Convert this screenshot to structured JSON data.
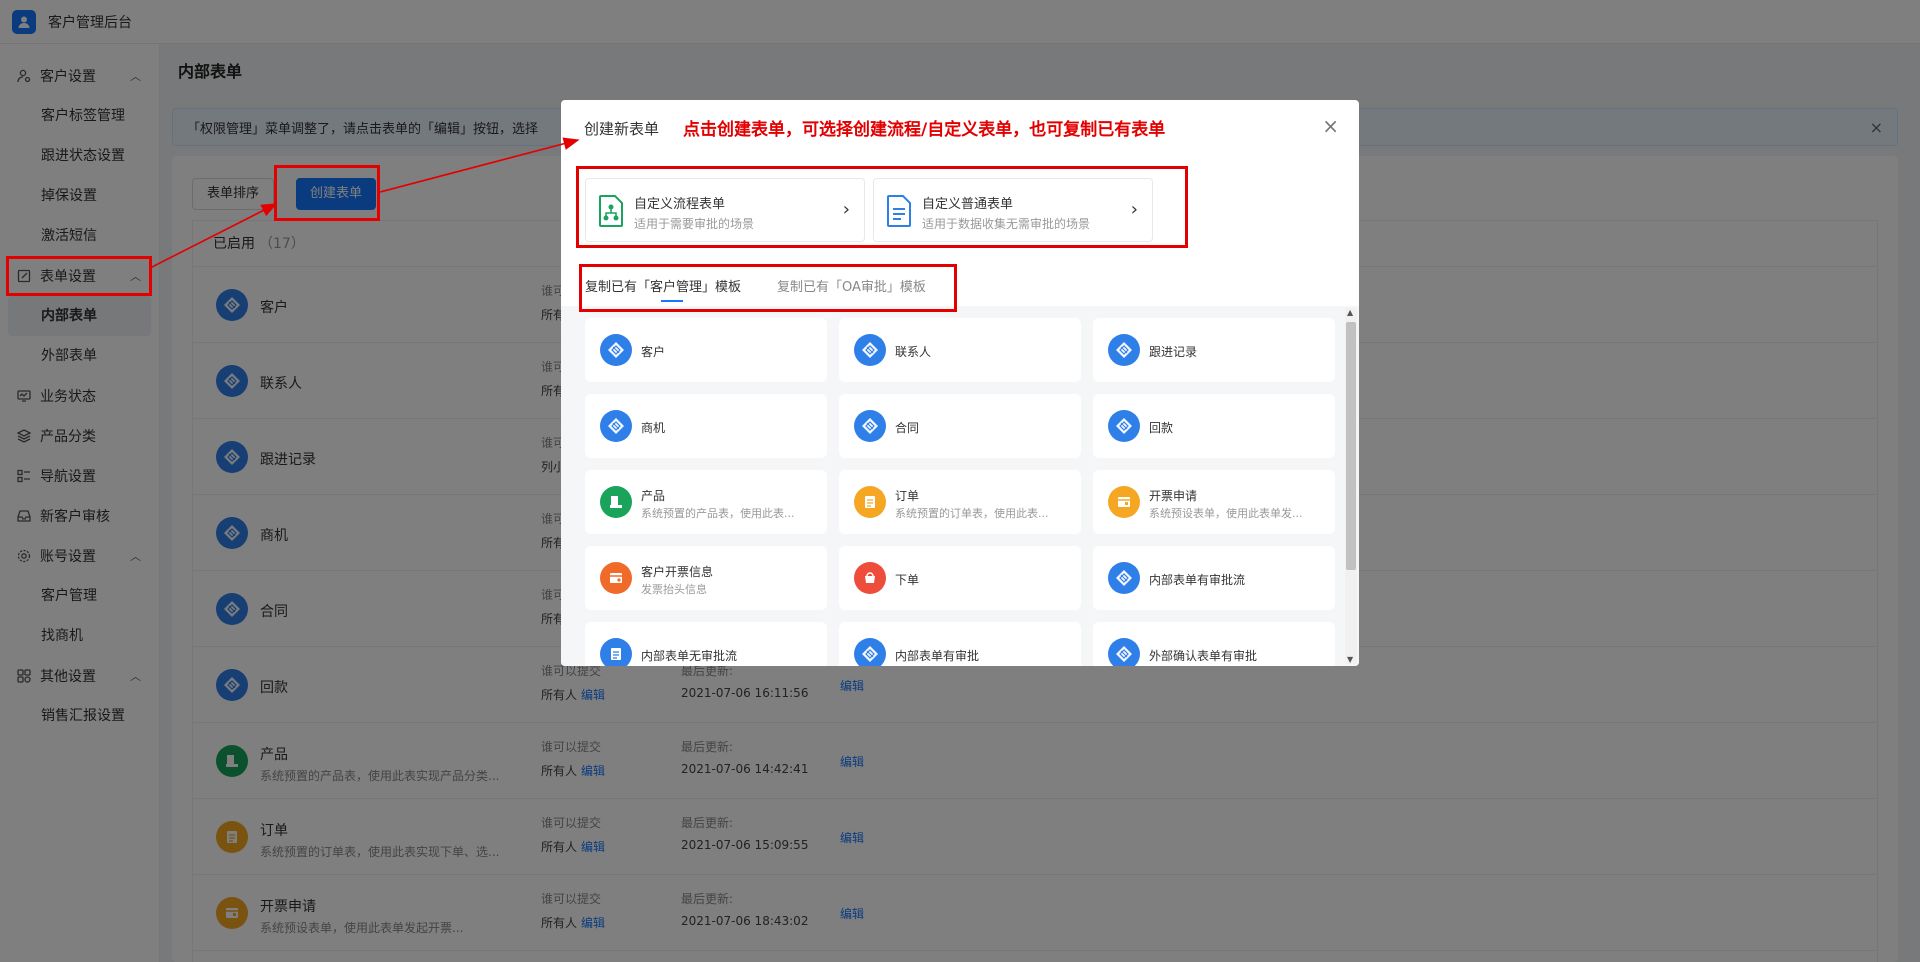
{
  "app": {
    "title": "客户管理后台"
  },
  "sidebar": {
    "groups": [
      {
        "label": "客户设置",
        "icon": "user-settings-icon",
        "expanded": true,
        "items": [
          "客户标签管理",
          "跟进状态设置",
          "掉保设置",
          "激活短信"
        ]
      },
      {
        "label": "表单设置",
        "icon": "form-edit-icon",
        "expanded": true,
        "items": [
          "内部表单",
          "外部表单"
        ],
        "active_item": "内部表单"
      },
      {
        "label": "业务状态",
        "icon": "monitor-icon"
      },
      {
        "label": "产品分类",
        "icon": "layers-icon"
      },
      {
        "label": "导航设置",
        "icon": "grid-list-icon"
      },
      {
        "label": "新客户审核",
        "icon": "inbox-icon"
      },
      {
        "label": "账号设置",
        "icon": "gear-icon",
        "expanded": true,
        "items": [
          "客户管理",
          "找商机"
        ]
      },
      {
        "label": "其他设置",
        "icon": "apps-icon",
        "expanded": true,
        "items": [
          "销售汇报设置"
        ]
      }
    ]
  },
  "main": {
    "page_title": "内部表单",
    "notice": "「权限管理」菜单调整了，请点击表单的「编辑」按钮，选择",
    "sort_button": "表单排序",
    "create_button": "创建表单",
    "list_header": "已启用",
    "list_count": "（17）",
    "who_label": "谁可以提交",
    "update_label": "最后更新:",
    "edit_label": "编辑",
    "rows": [
      {
        "name": "客户",
        "desc": "",
        "who": "所有人",
        "updated": "",
        "color": "#2f7fe8",
        "icon": "diamond-icon"
      },
      {
        "name": "联系人",
        "desc": "",
        "who": "所有人",
        "updated": "",
        "color": "#2f7fe8",
        "icon": "diamond-icon"
      },
      {
        "name": "跟进记录",
        "desc": "",
        "who": "列小强",
        "updated": "",
        "color": "#2f7fe8",
        "icon": "diamond-icon"
      },
      {
        "name": "商机",
        "desc": "",
        "who": "所有人",
        "updated": "",
        "color": "#2f7fe8",
        "icon": "diamond-icon"
      },
      {
        "name": "合同",
        "desc": "",
        "who": "所有人",
        "updated": "",
        "color": "#2f7fe8",
        "icon": "diamond-icon"
      },
      {
        "name": "回款",
        "desc": "",
        "who": "所有人",
        "updated": "2021-07-06 16:11:56",
        "color": "#2f7fe8",
        "icon": "diamond-icon"
      },
      {
        "name": "产品",
        "desc": "系统预置的产品表，使用此表实现产品分类...",
        "who": "所有人",
        "updated": "2021-07-06 14:42:41",
        "color": "#19a35b",
        "icon": "product-icon"
      },
      {
        "name": "订单",
        "desc": "系统预置的订单表，使用此表实现下单、选...",
        "who": "所有人",
        "updated": "2021-07-06 15:09:55",
        "color": "#f5a623",
        "icon": "order-icon"
      },
      {
        "name": "开票申请",
        "desc": "系统预设表单，使用此表单发起开票...",
        "who": "所有人",
        "updated": "2021-07-06 18:43:02",
        "color": "#f5a623",
        "icon": "invoice-icon"
      }
    ]
  },
  "modal": {
    "title": "创建新表单",
    "annotation": "点击创建表单，可选择创建流程/自定义表单，也可复制已有表单",
    "options": [
      {
        "title": "自定义流程表单",
        "desc": "适用于需要审批的场景",
        "color": "#19a35b",
        "icon": "flow-form-icon"
      },
      {
        "title": "自定义普通表单",
        "desc": "适用于数据收集无需审批的场景",
        "color": "#2f7fe8",
        "icon": "plain-form-icon"
      }
    ],
    "tabs": [
      "复制已有「客户管理」模板",
      "复制已有「OA审批」模板"
    ],
    "templates": [
      {
        "name": "客户",
        "desc": "",
        "color": "#2f7fe8",
        "icon": "diamond-icon"
      },
      {
        "name": "联系人",
        "desc": "",
        "color": "#2f7fe8",
        "icon": "diamond-icon"
      },
      {
        "name": "跟进记录",
        "desc": "",
        "color": "#2f7fe8",
        "icon": "diamond-icon"
      },
      {
        "name": "商机",
        "desc": "",
        "color": "#2f7fe8",
        "icon": "diamond-icon"
      },
      {
        "name": "合同",
        "desc": "",
        "color": "#2f7fe8",
        "icon": "diamond-icon"
      },
      {
        "name": "回款",
        "desc": "",
        "color": "#2f7fe8",
        "icon": "diamond-icon"
      },
      {
        "name": "产品",
        "desc": "系统预置的产品表，使用此表...",
        "color": "#19a35b",
        "icon": "product-icon"
      },
      {
        "name": "订单",
        "desc": "系统预置的订单表，使用此表...",
        "color": "#f5a623",
        "icon": "order-icon"
      },
      {
        "name": "开票申请",
        "desc": "系统预设表单，使用此表单发...",
        "color": "#f5a623",
        "icon": "invoice-icon"
      },
      {
        "name": "客户开票信息",
        "desc": "发票抬头信息",
        "color": "#f06a2a",
        "icon": "invoice-info-icon"
      },
      {
        "name": "下单",
        "desc": "",
        "color": "#ef4d3c",
        "icon": "cart-icon"
      },
      {
        "name": "内部表单有审批流",
        "desc": "",
        "color": "#2f7fe8",
        "icon": "diamond-icon"
      },
      {
        "name": "内部表单无审批流",
        "desc": "",
        "color": "#2f7fe8",
        "icon": "clipboard-icon"
      },
      {
        "name": "内部表单有审批",
        "desc": "",
        "color": "#2f7fe8",
        "icon": "diamond-icon"
      },
      {
        "name": "外部确认表单有审批",
        "desc": "",
        "color": "#2f7fe8",
        "icon": "diamond-icon"
      }
    ]
  },
  "colors": {
    "accent": "#1677ff",
    "annotation": "#e30000"
  }
}
